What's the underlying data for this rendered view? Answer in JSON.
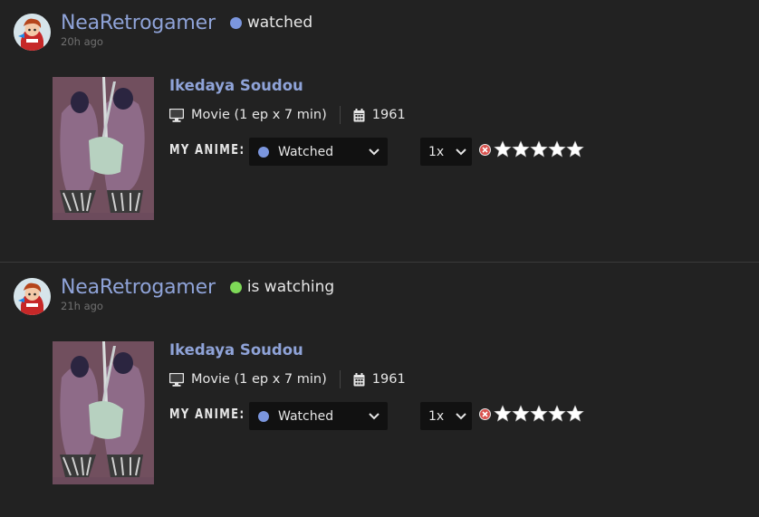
{
  "feed": [
    {
      "username": "NeaRetrogamer",
      "status_text": "watched",
      "status_color": "#7b96de",
      "timestamp": "20h ago",
      "anime": {
        "title": "Ikedaya Soudou",
        "type_info": "Movie (1 ep x 7 min)",
        "year": "1961",
        "my_anime_label": "MY ANIME:",
        "status_value": "Watched",
        "speed_value": "1x",
        "rating": 0,
        "max_rating": 5
      }
    },
    {
      "username": "NeaRetrogamer",
      "status_text": "is watching",
      "status_color": "#7ed957",
      "timestamp": "21h ago",
      "anime": {
        "title": "Ikedaya Soudou",
        "type_info": "Movie (1 ep x 7 min)",
        "year": "1961",
        "my_anime_label": "MY ANIME:",
        "status_value": "Watched",
        "speed_value": "1x",
        "rating": 0,
        "max_rating": 5
      }
    }
  ],
  "icons": {
    "type_icon": "monitor-icon",
    "year_icon": "calendar-icon",
    "dropdown_icon": "chevron-down-icon",
    "clear_rating_icon": "close-circle-icon",
    "rating_icon": "star-icon"
  },
  "colors": {
    "background": "#222222",
    "link": "#8fa3d8",
    "watched_dot": "#7b96de",
    "watching_dot": "#7ed957"
  }
}
